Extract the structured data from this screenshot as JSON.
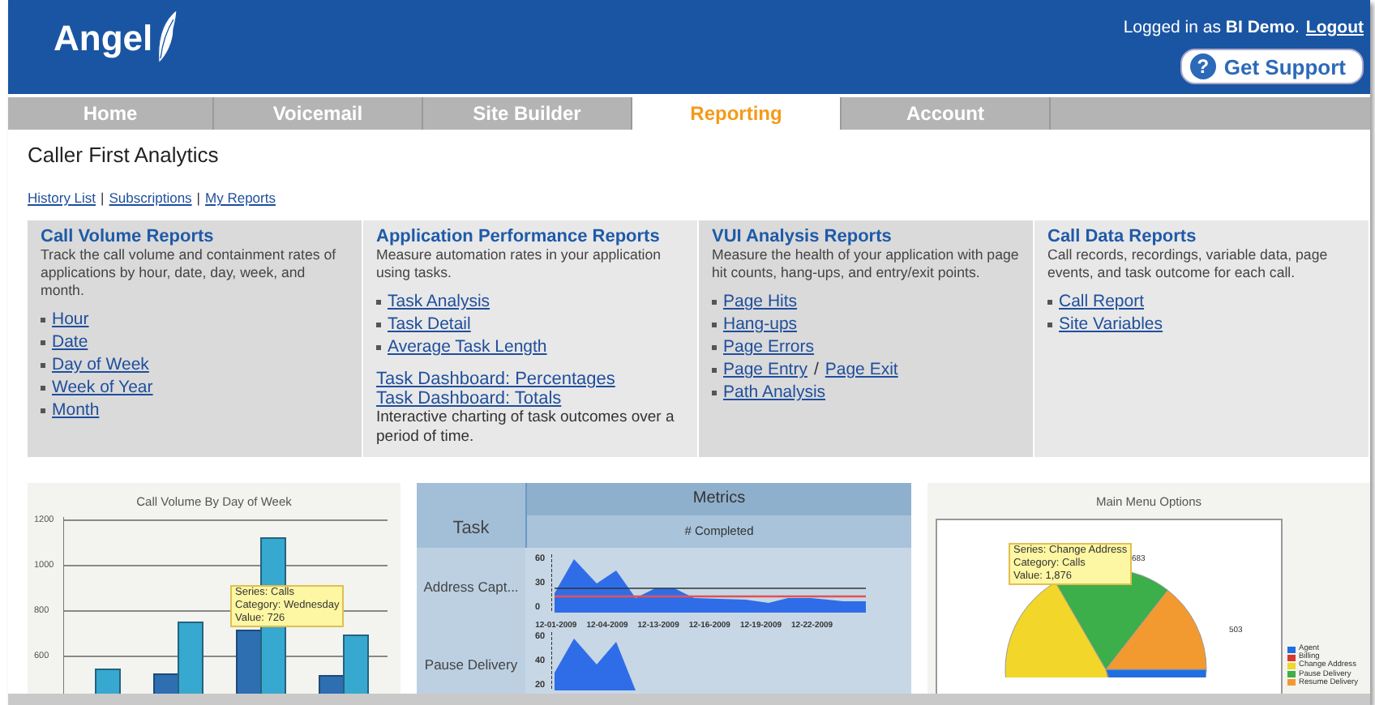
{
  "header": {
    "logo": "Angel",
    "login_text": "Logged in as **BI Demo**.",
    "logout": "Logout",
    "help_glyph": "?",
    "support_button": "Get Support"
  },
  "tabs": [
    {
      "label": "Home",
      "selected": false
    },
    {
      "label": "Voicemail",
      "selected": false
    },
    {
      "label": "Site Builder",
      "selected": false
    },
    {
      "label": "Reporting",
      "selected": true
    },
    {
      "label": "Account",
      "selected": false
    }
  ],
  "page_title": "Caller First Analytics",
  "sub_links": {
    "separator": "|",
    "links": [
      "History List",
      "Subscriptions",
      "My Reports"
    ]
  },
  "panels": [
    {
      "title": "Call Volume Reports",
      "description": "Track the call volume and containment rates of applications by hour, date, day, week, and month.",
      "items": [
        {
          "links": [
            "Hour"
          ]
        },
        {
          "links": [
            "Date"
          ]
        },
        {
          "links": [
            "Day of Week"
          ]
        },
        {
          "links": [
            "Week of Year"
          ]
        },
        {
          "links": [
            "Month"
          ]
        }
      ]
    },
    {
      "title": "Application Performance Reports",
      "description": "Measure automation rates in your application using tasks.",
      "items": [
        {
          "links": [
            "Task Analysis"
          ]
        },
        {
          "links": [
            "Task Detail"
          ]
        },
        {
          "links": [
            "Average Task Length"
          ]
        }
      ],
      "extra_links": [
        "Task Dashboard: Percentages",
        "Task Dashboard: Totals"
      ],
      "note": "Interactive charting of task outcomes over a period of time."
    },
    {
      "title": "VUI Analysis Reports",
      "description": "Measure the health of your application with page hit counts, hang-ups, and entry/exit points.",
      "items": [
        {
          "links": [
            "Page Hits"
          ]
        },
        {
          "links": [
            "Hang-ups"
          ]
        },
        {
          "links": [
            "Page Errors"
          ]
        },
        {
          "links": [
            "Page Entry",
            "Page Exit"
          ],
          "joiner": "/"
        },
        {
          "links": [
            "Path Analysis"
          ]
        }
      ]
    },
    {
      "title": "Call Data Reports",
      "description": "Call records, recordings, variable data, page events, and task outcome for each call.",
      "items": [
        {
          "links": [
            "Call Report"
          ]
        },
        {
          "links": [
            "Site Variables"
          ]
        }
      ]
    }
  ],
  "bar_chart": {
    "title": "Call Volume By  Day of Week",
    "yticks": [
      "1200",
      "1000",
      "800",
      "600"
    ],
    "tooltip": [
      "Series: Calls",
      "Category: Wednesday",
      "Value: 726"
    ]
  },
  "metrics": {
    "header": "Metrics",
    "task_header": "Task",
    "column": "# Completed",
    "xticks": [
      "12-01-2009",
      "12-04-2009",
      "12-13-2009",
      "12-16-2009",
      "12-19-2009",
      "12-22-2009"
    ],
    "rows": [
      {
        "task": "Address Capt...",
        "yticks": [
          "60",
          "30",
          "0"
        ]
      },
      {
        "task": "Pause Delivery",
        "yticks": [
          "60",
          "40",
          "20"
        ]
      }
    ]
  },
  "pie_chart": {
    "title": "Main Menu Options",
    "tooltip": [
      "Series: Change Address",
      "Category: Calls",
      "Value: 1,876"
    ],
    "labels": [
      "683",
      "503"
    ],
    "legend": [
      {
        "label": "Agent",
        "color": "#1f6fe0"
      },
      {
        "label": "Billing",
        "color": "#d83a2a"
      },
      {
        "label": "Change Address",
        "color": "#f2d62a"
      },
      {
        "label": "Pause Delivery",
        "color": "#3cae4a"
      },
      {
        "label": "Resume Delivery",
        "color": "#f29a30"
      }
    ]
  }
}
